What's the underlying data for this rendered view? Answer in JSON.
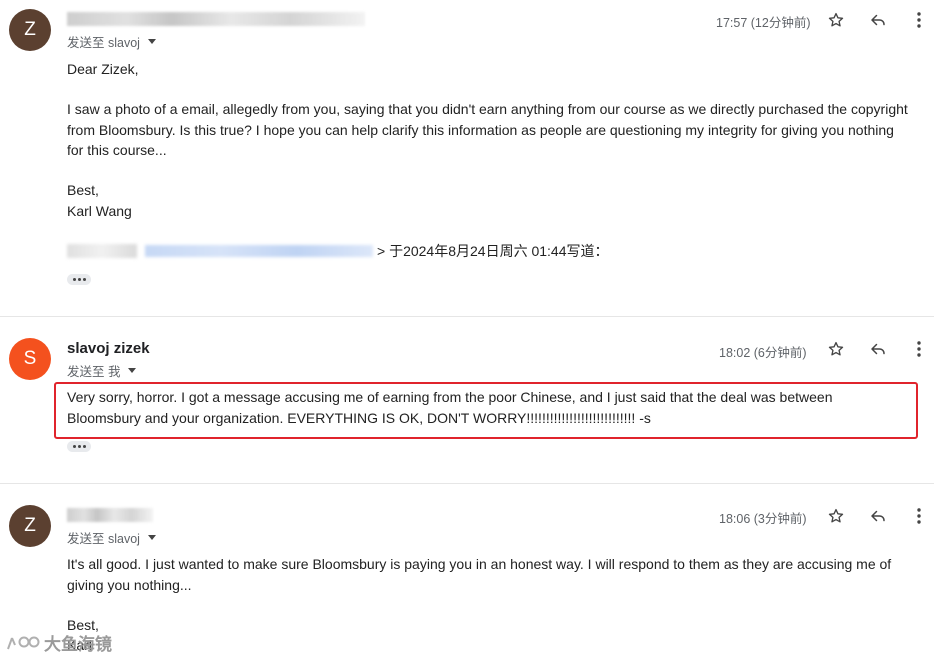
{
  "messages": [
    {
      "avatar_letter": "Z",
      "avatar_color": "#5b4030",
      "to_line": "发送至 slavoj",
      "time": "17:57 (12分钟前)",
      "greeting": "Dear Zizek,",
      "paragraph": "I saw a photo of a email, allegedly from you, saying that you didn't earn anything from our course as we directly purchased the copyright from Bloomsbury. Is this true? I hope you can help clarify this information as people are questioning my integrity for giving you nothing for this course...",
      "signoff": "Best,",
      "signature": "Karl Wang",
      "quote_suffix": "> 于2024年8月24日周六 01:44写道："
    },
    {
      "avatar_letter": "S",
      "avatar_color": "#f4511e",
      "sender_name": "slavoj zizek",
      "to_line": "发送至 我",
      "time": "18:02 (6分钟前)",
      "body": "Very sorry, horror. I got a message accusing me of earning from the poor Chinese, and I just said that the deal was between Bloomsbury and your organization. EVERYTHING IS OK, DON'T WORRY!!!!!!!!!!!!!!!!!!!!!!!!!!!! -s"
    },
    {
      "avatar_letter": "Z",
      "avatar_color": "#5b4030",
      "to_line": "发送至 slavoj",
      "time": "18:06 (3分钟前)",
      "body": "It's all good. I just wanted to make sure Bloomsbury is paying you in an honest way. I will respond to them as they are accusing me of giving you nothing...",
      "signoff": "Best,",
      "signature": "Karl"
    }
  ],
  "icons": [
    "star-icon",
    "reply-icon",
    "more-vert-icon"
  ],
  "highlight_color": "#e0242c",
  "watermark": "大鱼海镜"
}
